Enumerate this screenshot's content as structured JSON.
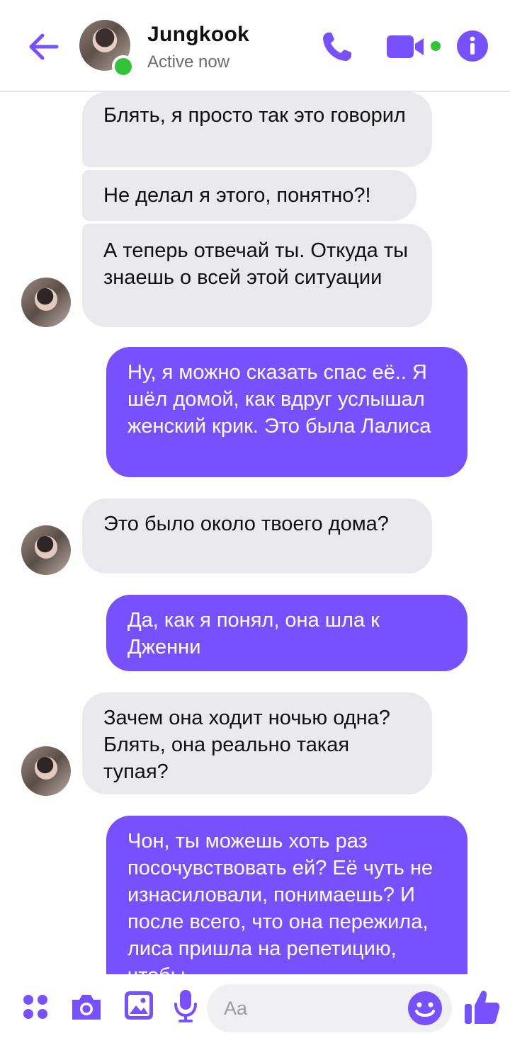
{
  "header": {
    "name": "Jungkook",
    "status": "Active now"
  },
  "messages": [
    {
      "id": "m1",
      "from": "them",
      "text": "Блять, я просто так это говорил"
    },
    {
      "id": "m2",
      "from": "them",
      "text": "Не делал я этого, понятно?!"
    },
    {
      "id": "m3",
      "from": "them",
      "text": "А теперь отвечай ты. Откуда ты знаешь о всей этой ситуации"
    },
    {
      "id": "m4",
      "from": "me",
      "text": "Ну, я можно сказать спас её.. Я шёл домой, как вдруг услышал женский крик. Это была Лалиса"
    },
    {
      "id": "m5",
      "from": "them",
      "text": "Это было около твоего дома?"
    },
    {
      "id": "m6",
      "from": "me",
      "text": "Да, как я понял, она шла к Дженни"
    },
    {
      "id": "m7",
      "from": "them",
      "text": "Зачем она ходит ночью одна? Блять, она реально такая тупая?"
    },
    {
      "id": "m8",
      "from": "me",
      "text": "Чон, ты можешь хоть раз посочувствовать ей? Её чуть не изнасиловали, понимаешь? И после всего, что она пережила, лиса пришла на репетицию, чтобы"
    }
  ],
  "composer": {
    "placeholder": "Aa"
  },
  "colors": {
    "accent": "#7751ff",
    "incoming_bubble": "#e9e9ee",
    "online": "#31c43a"
  },
  "icons": [
    "back-arrow-icon",
    "phone-icon",
    "video-camera-icon",
    "info-icon",
    "apps-grid-icon",
    "camera-icon",
    "gallery-icon",
    "microphone-icon",
    "emoji-icon",
    "thumbs-up-icon"
  ]
}
